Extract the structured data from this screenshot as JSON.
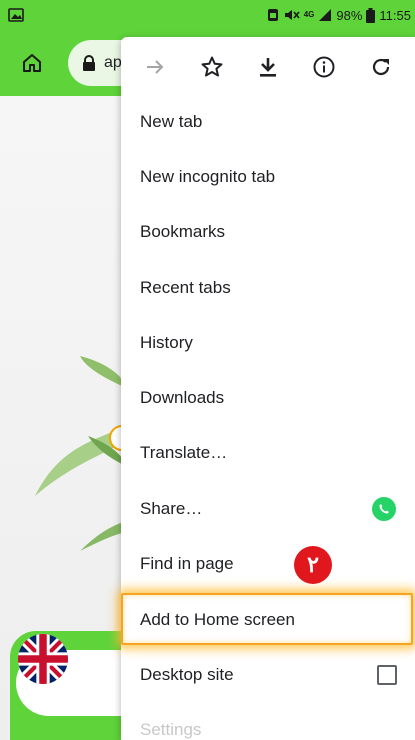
{
  "status_bar": {
    "battery": "98%",
    "time": "11:55",
    "network": "4G"
  },
  "toolbar": {
    "url_text": "ap"
  },
  "menu": {
    "top_icons": [
      "forward-arrow-icon",
      "star-icon",
      "download-icon",
      "info-icon",
      "refresh-icon"
    ],
    "items": [
      {
        "label": "New tab"
      },
      {
        "label": "New incognito tab"
      },
      {
        "label": "Bookmarks"
      },
      {
        "label": "Recent tabs"
      },
      {
        "label": "History"
      },
      {
        "label": "Downloads"
      },
      {
        "label": "Translate…"
      },
      {
        "label": "Share…"
      },
      {
        "label": "Find in page"
      },
      {
        "label": "Add to Home screen"
      },
      {
        "label": "Desktop site"
      },
      {
        "label": "Settings"
      }
    ],
    "desktop_site_checked": false
  },
  "annotation": {
    "step_badge": "٢"
  },
  "colors": {
    "accent_green": "#5fd33a",
    "highlight_orange": "#f5a524",
    "badge_red": "#e0171d",
    "whatsapp_green": "#25d366"
  }
}
